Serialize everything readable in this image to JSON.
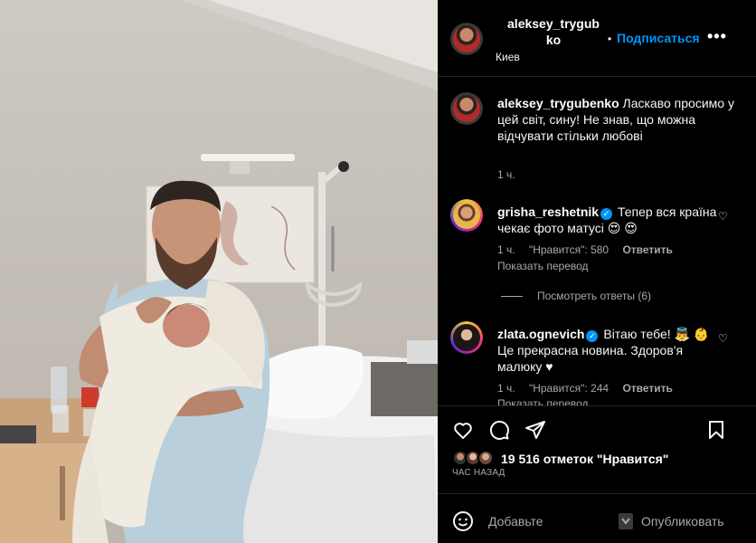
{
  "post": {
    "author": "aleksey_trygubenko",
    "author_line1": "aleksey_trygub",
    "author_line2": "ko",
    "author_display": "aleksey_trygubenko",
    "follow_label": "Подписаться",
    "dot": "•",
    "more_label": "•••",
    "location": "Киев",
    "caption_user": "aleksey_trygubenko",
    "caption_text": " Ласкаво просимо у цей світ, сину! Не знав, що можна відчувати стільки любові",
    "caption_time": "1 ч."
  },
  "comments": [
    {
      "user": "grisha_reshetnik",
      "verified": true,
      "text": " Тепер вся країна чекає фото матусі 😍 😍",
      "time": "1 ч.",
      "likes": "\"Нравится\": 580",
      "reply_label": "Ответить",
      "translate_label": "Показать перевод",
      "view_replies": "Посмотреть ответы (6)"
    },
    {
      "user": "zlata.ognevich",
      "verified": true,
      "text": " Вітаю тебе! 👼 👶 Це прекрасна новина. Здоров'я малюку ♥",
      "time": "1 ч.",
      "likes": "\"Нравится\": 244",
      "reply_label": "Ответить",
      "translate_label": "Показать перевод"
    }
  ],
  "actions": {
    "like_icon": "heart-icon",
    "comment_icon": "comment-icon",
    "share_icon": "share-icon",
    "save_icon": "bookmark-icon"
  },
  "likes_summary": "19 516 отметок \"Нравится\"",
  "posted_ago": "ЧАС НАЗАД",
  "composer": {
    "emoji_icon": "emoji-icon",
    "placeholder": "Добавьте",
    "publish_label": "Опубликовать"
  },
  "colors": {
    "accent": "#0095f6",
    "background": "#000000",
    "muted": "#a8a8a8"
  }
}
